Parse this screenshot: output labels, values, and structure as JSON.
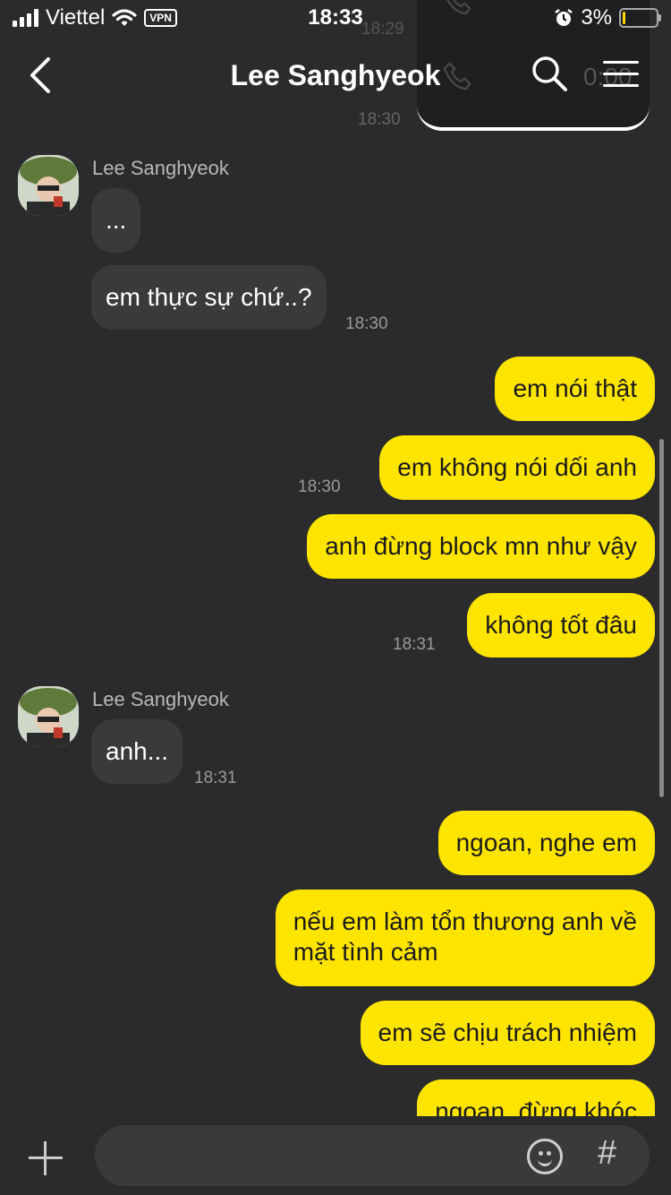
{
  "status_bar": {
    "carrier": "Viettel",
    "vpn": "VPN",
    "time": "18:33",
    "battery": "3%",
    "battery_level_percent": 3
  },
  "header": {
    "title": "Lee Sanghyeok"
  },
  "background_call": {
    "duration": "0:00",
    "time_top": "18:29",
    "time_bottom": "18:30"
  },
  "messages": [
    {
      "direction": "in",
      "sender": "Lee Sanghyeok",
      "text": "...",
      "time": ""
    },
    {
      "direction": "in",
      "text": "em thực sự chứ..?",
      "time": "18:30"
    },
    {
      "direction": "out",
      "text": "em nói thật",
      "time": ""
    },
    {
      "direction": "out",
      "text": "em không nói dối anh",
      "time": "18:30"
    },
    {
      "direction": "out",
      "text": "anh đừng block mn như vậy",
      "time": ""
    },
    {
      "direction": "out",
      "text": "không tốt đâu",
      "time": "18:31"
    },
    {
      "direction": "in",
      "sender": "Lee Sanghyeok",
      "text": "anh...",
      "time": "18:31"
    },
    {
      "direction": "out",
      "text": "ngoan, nghe em",
      "time": ""
    },
    {
      "direction": "out",
      "text": "nếu em làm tổn thương anh về",
      "text2": "mặt tình cảm",
      "time": ""
    },
    {
      "direction": "out",
      "text": "em sẽ chịu trách nhiệm",
      "time": ""
    },
    {
      "direction": "out",
      "text": "ngoan, đừng khóc",
      "time": ""
    }
  ],
  "composer": {
    "placeholder": "",
    "hash_label": "#"
  }
}
